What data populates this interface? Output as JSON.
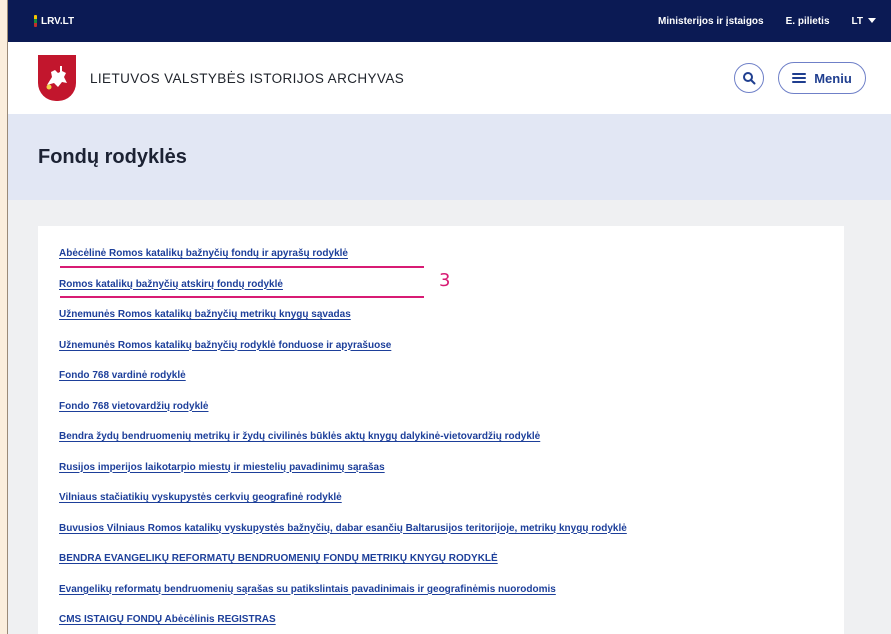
{
  "topbar": {
    "brand": "LRV.LT",
    "links": [
      "Ministerijos ir įstaigos",
      "E. pilietis",
      "LT"
    ]
  },
  "header": {
    "title": "LIETUVOS VALSTYBĖS ISTORIJOS ARCHYVAS",
    "menu_label": "Meniu",
    "search_icon": "search-icon",
    "menu_icon": "hamburger-icon"
  },
  "page": {
    "title": "Fondų rodyklės"
  },
  "annotation": {
    "label": "3",
    "color": "#d81b74"
  },
  "links": [
    "Abėcėlinė Romos katalikų bažnyčių fondų ir apyrašų rodyklė",
    "Romos katalikų bažnyčių atskirų fondų rodyklė",
    "Užnemunės Romos katalikų bažnyčių metrikų knygų sąvadas",
    "Užnemunės Romos katalikų bažnyčių rodyklė fonduose ir apyrašuose",
    "Fondo  768 vardinė rodyklė",
    "Fondo 768 vietovardžių rodyklė",
    "Bendra žydų bendruomenių metrikų ir žydų civilinės būklės aktų knygų dalykinė-vietovardžių rodyklė",
    "Rusijos imperijos laikotarpio miestų ir miestelių pavadinimų sąrašas",
    "Vilniaus stačiatikių vyskupystės cerkvių geografinė rodyklė",
    "Buvusios Vilniaus Romos katalikų vyskupystės bažnyčių, dabar esančių Baltarusijos teritorijoje, metrikų knygų rodyklė",
    "BENDRA EVANGELIKŲ REFORMATŲ BENDRUOMENIŲ FONDŲ METRIKŲ KNYGŲ RODYKLĖ",
    "Evangelikų reformatų bendruomenių sąrašas su patikslintais pavadinimais ir geografinėmis nuorodomis",
    "CMS ISTAIGŲ FONDŲ Abėcėlinis REGISTRAS"
  ],
  "colors": {
    "topbar": "#0b1a54",
    "link": "#1d3f9a",
    "hero": "#e2e7f4",
    "highlight": "#d81b74"
  }
}
